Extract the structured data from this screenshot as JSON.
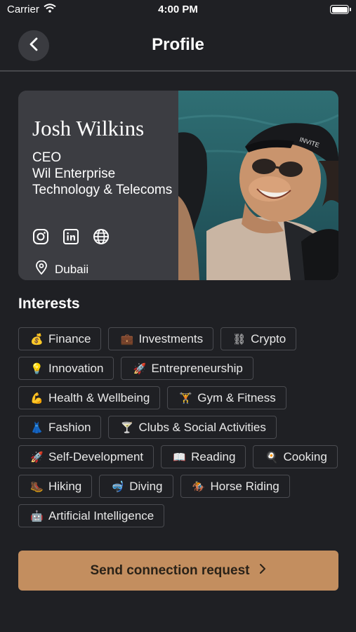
{
  "status_bar": {
    "carrier": "Carrier",
    "time": "4:00 PM"
  },
  "nav": {
    "title": "Profile"
  },
  "profile": {
    "name": "Josh Wilkins",
    "role": "CEO",
    "company": "Wil Enterprise Technology & Telecoms",
    "location": "Dubaii",
    "socials": [
      "instagram-icon",
      "linkedin-icon",
      "globe-icon"
    ]
  },
  "interests": {
    "title": "Interests",
    "items": [
      {
        "emoji": "💰",
        "label": "Finance"
      },
      {
        "emoji": "💼",
        "label": "Investments"
      },
      {
        "emoji": "⛓",
        "label": "Crypto"
      },
      {
        "emoji": "💡",
        "label": "Innovation"
      },
      {
        "emoji": "🚀",
        "label": "Entrepreneurship"
      },
      {
        "emoji": "💪",
        "label": "Health & Wellbeing"
      },
      {
        "emoji": "🏋",
        "label": "Gym & Fitness"
      },
      {
        "emoji": "👗",
        "label": "Fashion"
      },
      {
        "emoji": "🍸",
        "label": "Clubs & Social Activities"
      },
      {
        "emoji": "🚀",
        "label": "Self-Development"
      },
      {
        "emoji": "📖",
        "label": "Reading"
      },
      {
        "emoji": "🍳",
        "label": "Cooking"
      },
      {
        "emoji": "🥾",
        "label": "Hiking"
      },
      {
        "emoji": "🤿",
        "label": "Diving"
      },
      {
        "emoji": "🏇",
        "label": "Horse Riding"
      },
      {
        "emoji": "🤖",
        "label": "Artificial Intelligence"
      }
    ]
  },
  "cta": {
    "label": "Send connection request"
  },
  "colors": {
    "background": "#1f2024",
    "card": "#3c3d42",
    "accent": "#c38e5f",
    "chip_border": "#4a4b50"
  }
}
